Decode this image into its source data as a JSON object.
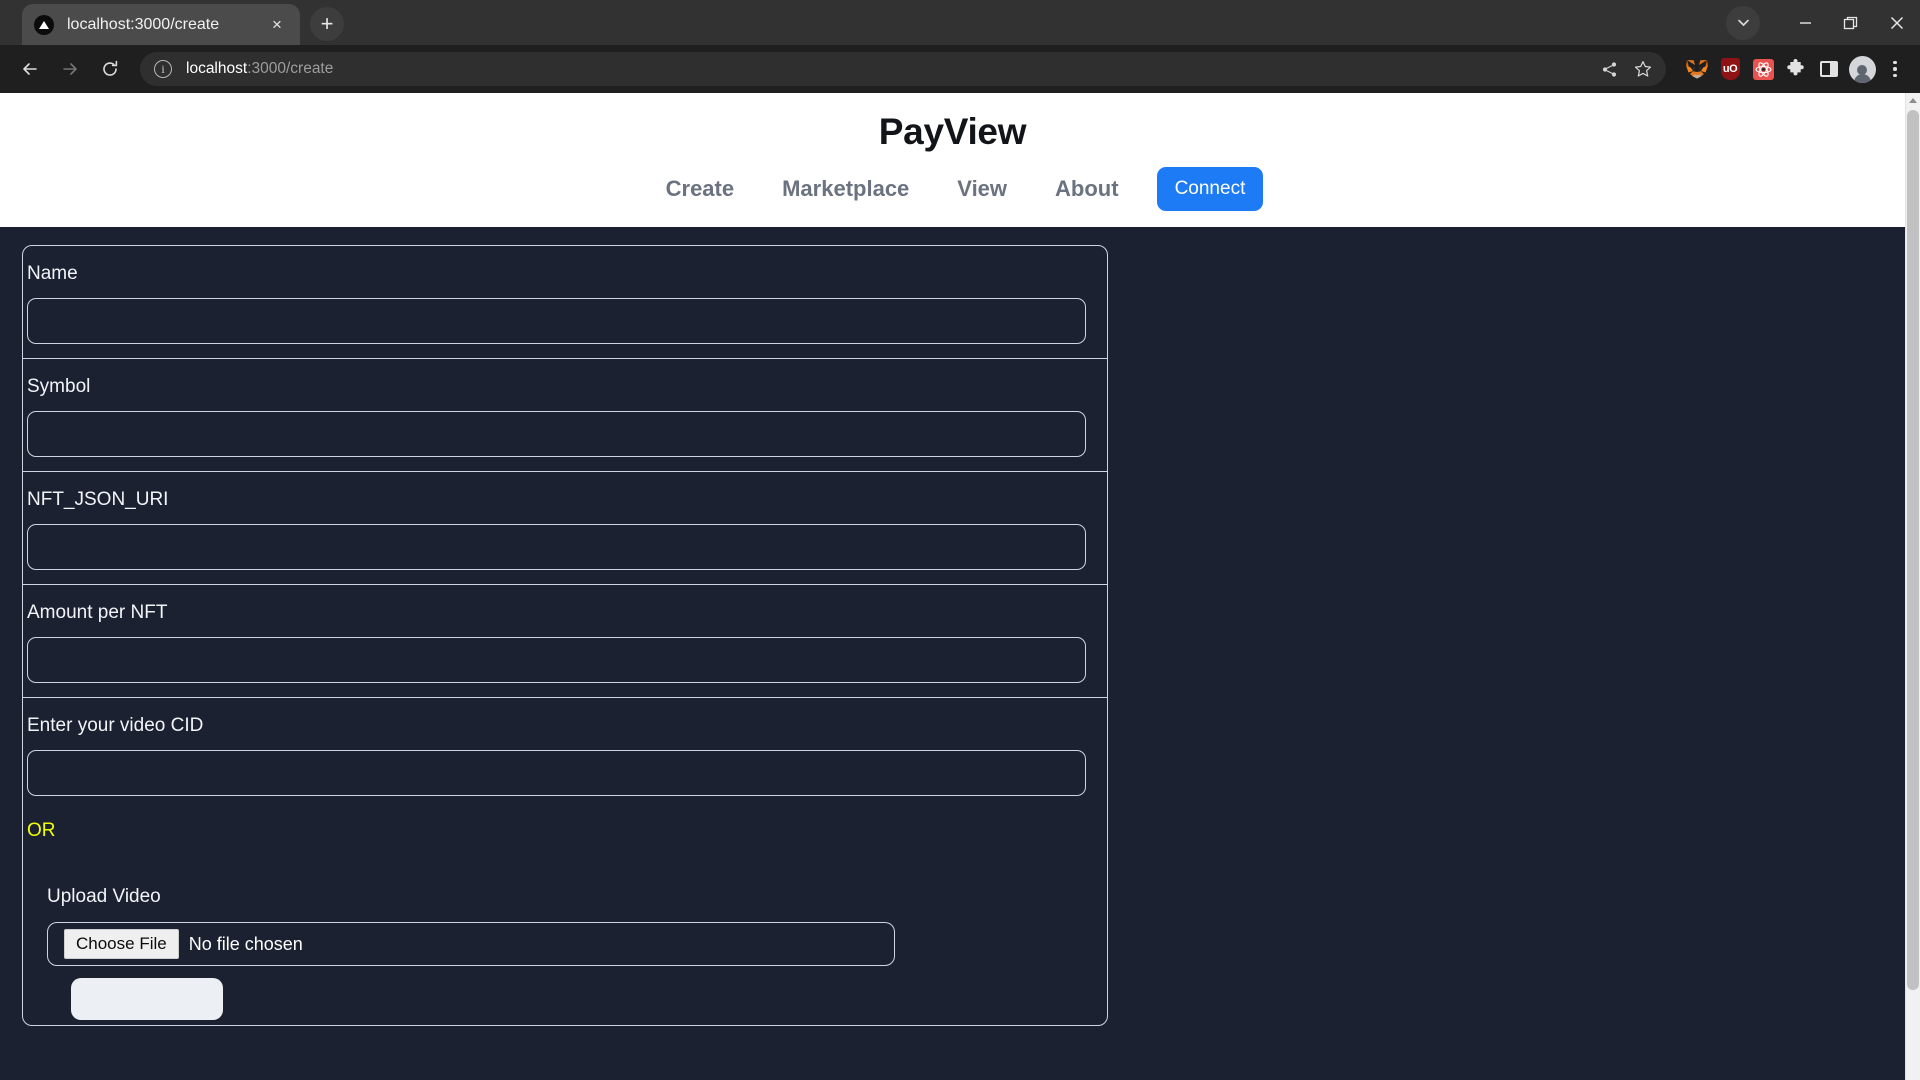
{
  "browser": {
    "tab": {
      "title": "localhost:3000/create",
      "favicon": "triangle-logo-icon",
      "close_label": "×"
    },
    "new_tab_label": "+",
    "window_controls": {
      "tab_search": "tab-search-icon",
      "minimize": "minimize-icon",
      "maximize": "maximize-icon",
      "close": "close-icon"
    },
    "toolbar": {
      "back": "back-arrow-icon",
      "forward": "forward-arrow-icon",
      "reload": "reload-icon",
      "omnibox": {
        "info_icon": "ⓘ",
        "host": "localhost",
        "path": ":3000/create",
        "full_url": "localhost:3000/create"
      },
      "share_icon": "share-icon",
      "bookmark_icon": "star-icon",
      "extensions": [
        {
          "name": "metamask-extension-icon",
          "glyph": "🦊"
        },
        {
          "name": "ublock-origin-extension-icon",
          "glyph": "uO"
        },
        {
          "name": "react-devtools-extension-icon",
          "glyph": "⚛"
        },
        {
          "name": "extensions-puzzle-icon",
          "glyph": "🧩"
        }
      ],
      "side_panel_icon": "side-panel-icon",
      "profile_icon": "profile-avatar-icon",
      "menu_icon": "three-dot-menu-icon"
    }
  },
  "site": {
    "title": "PayView",
    "nav": [
      {
        "label": "Create"
      },
      {
        "label": "Marketplace"
      },
      {
        "label": "View"
      },
      {
        "label": "About"
      }
    ],
    "connect_label": "Connect",
    "accent_color": "#1d7bf5",
    "header_bg": "#ffffff",
    "body_bg": "#1b2130",
    "border_color": "#ced4e0",
    "or_color": "#f2ff00"
  },
  "form": {
    "fields": [
      {
        "label": "Name",
        "value": "",
        "placeholder": ""
      },
      {
        "label": "Symbol",
        "value": "",
        "placeholder": ""
      },
      {
        "label": "NFT_JSON_URI",
        "value": "",
        "placeholder": ""
      },
      {
        "label": "Amount per NFT",
        "value": "",
        "placeholder": ""
      },
      {
        "label": "Enter your video CID",
        "value": "",
        "placeholder": ""
      }
    ],
    "or_label": "OR",
    "upload_label": "Upload Video",
    "choose_file_label": "Choose File",
    "file_status": "No file chosen",
    "submit_label": ""
  },
  "scrollbar": {
    "up_arrow": "scroll-up-arrow-icon",
    "position": "top"
  }
}
